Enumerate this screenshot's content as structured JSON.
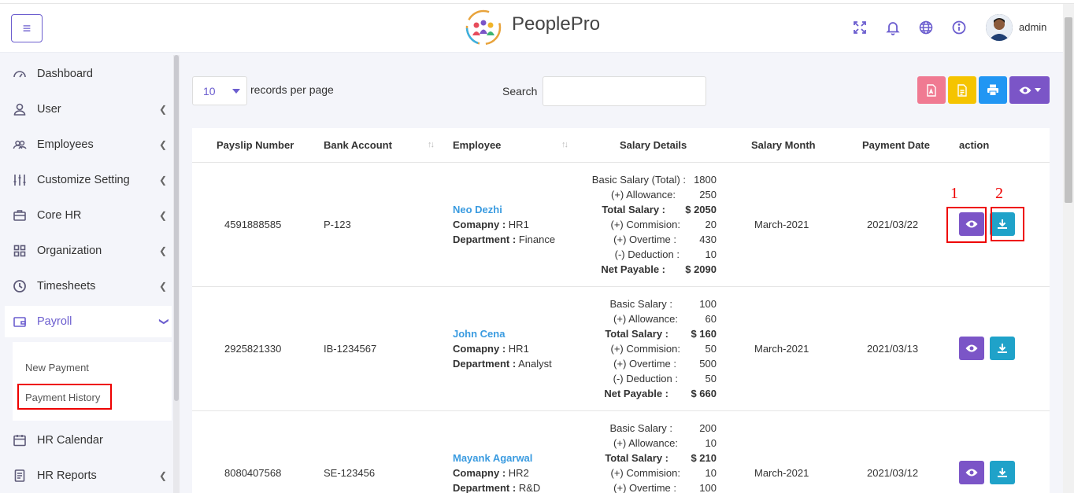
{
  "header": {
    "app_name": "PeoplePro",
    "user_name": "admin",
    "icons": [
      "menu-icon",
      "fullscreen-icon",
      "bell-icon",
      "globe-icon",
      "info-icon"
    ]
  },
  "sidebar": {
    "items": [
      {
        "label": "Dashboard",
        "icon": "dashboard-icon",
        "has_chevron": false
      },
      {
        "label": "User",
        "icon": "user-icon",
        "has_chevron": true
      },
      {
        "label": "Employees",
        "icon": "employees-icon",
        "has_chevron": true
      },
      {
        "label": "Customize Setting",
        "icon": "sliders-icon",
        "has_chevron": true
      },
      {
        "label": "Core HR",
        "icon": "briefcase-icon",
        "has_chevron": true
      },
      {
        "label": "Organization",
        "icon": "grid-icon",
        "has_chevron": true
      },
      {
        "label": "Timesheets",
        "icon": "clock-icon",
        "has_chevron": true
      },
      {
        "label": "Payroll",
        "icon": "wallet-icon",
        "has_chevron": true,
        "expanded": true
      },
      {
        "label": "HR Calendar",
        "icon": "calendar-icon",
        "has_chevron": false
      },
      {
        "label": "HR Reports",
        "icon": "report-icon",
        "has_chevron": true
      }
    ],
    "payroll_sub": [
      "New Payment",
      "Payment History"
    ]
  },
  "controls": {
    "page_length": "10",
    "length_label": "records per page",
    "search_label": "Search",
    "search_value": ""
  },
  "table": {
    "headers": [
      "Payslip Number",
      "Bank Account",
      "Employee",
      "Salary Details",
      "Salary Month",
      "Payment Date",
      "action"
    ],
    "rows": [
      {
        "payslip": "4591888585",
        "bank": "P-123",
        "emp_name": "Neo Dezhi",
        "company_label": "Comapny :",
        "company": "HR1",
        "dept_label": "Department :",
        "dept": "Finance",
        "salary": [
          {
            "label": "Basic Salary (Total) :",
            "value": "1800",
            "bold": false
          },
          {
            "label": "(+) Allowance:",
            "value": "250",
            "bold": false
          },
          {
            "label": "Total Salary :",
            "value": "$ 2050",
            "bold": true
          },
          {
            "label": "(+) Commision:",
            "value": "20",
            "bold": false
          },
          {
            "label": "(+) Overtime  :",
            "value": "430",
            "bold": false
          },
          {
            "label": "(-) Deduction  :",
            "value": "10",
            "bold": false
          },
          {
            "label": "Net Payable :",
            "value": "$ 2090",
            "bold": true
          }
        ],
        "month": "March-2021",
        "date": "2021/03/22"
      },
      {
        "payslip": "2925821330",
        "bank": "IB-1234567",
        "emp_name": "John Cena",
        "company_label": "Comapny :",
        "company": "HR1",
        "dept_label": "Department :",
        "dept": "Analyst",
        "salary": [
          {
            "label": "Basic Salary :",
            "value": "100",
            "bold": false
          },
          {
            "label": "(+) Allowance:",
            "value": "60",
            "bold": false
          },
          {
            "label": "Total Salary :",
            "value": "$ 160",
            "bold": true
          },
          {
            "label": "(+) Commision:",
            "value": "50",
            "bold": false
          },
          {
            "label": "(+) Overtime  :",
            "value": "500",
            "bold": false
          },
          {
            "label": "(-) Deduction :",
            "value": "50",
            "bold": false
          },
          {
            "label": "Net Payable :",
            "value": "$ 660",
            "bold": true
          }
        ],
        "month": "March-2021",
        "date": "2021/03/13"
      },
      {
        "payslip": "8080407568",
        "bank": "SE-123456",
        "emp_name": "Mayank Agarwal",
        "company_label": "Comapny :",
        "company": "HR2",
        "dept_label": "Department :",
        "dept": "R&D",
        "salary": [
          {
            "label": "Basic Salary :",
            "value": "200",
            "bold": false
          },
          {
            "label": "(+) Allowance:",
            "value": "10",
            "bold": false
          },
          {
            "label": "Total Salary :",
            "value": "$ 210",
            "bold": true
          },
          {
            "label": "(+) Commision:",
            "value": "10",
            "bold": false
          },
          {
            "label": "(+) Overtime  :",
            "value": "100",
            "bold": false
          }
        ],
        "month": "March-2021",
        "date": "2021/03/12"
      }
    ]
  },
  "annotations": [
    "1",
    "2"
  ],
  "colors": {
    "accent": "#6c5ecf",
    "view_button": "#7b55c7",
    "download_button": "#1fa2c9",
    "pdf_button": "#f07a92",
    "csv_button": "#f5c400",
    "print_button": "#2196f3",
    "visibility_button": "#7b55c7",
    "annotation": "#e00000"
  }
}
